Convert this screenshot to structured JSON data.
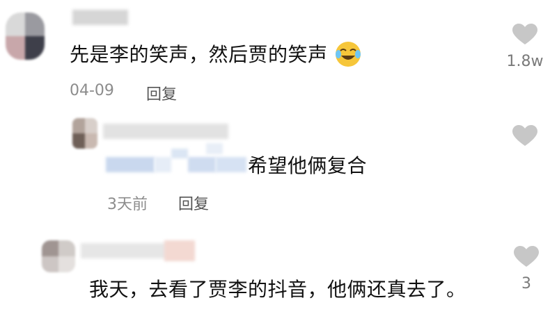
{
  "comments": [
    {
      "text": "先是李的笑声，然后贾的笑声",
      "date": "04-09",
      "reply_label": "回复",
      "like_count": "1.8w",
      "emoji": "laughing-crying-emoji"
    },
    {
      "text": "希望他俩复合",
      "date": "3天前",
      "reply_label": "回复",
      "like_count": ""
    },
    {
      "text": "我天，去看了贾李的抖音，他俩还真去了。",
      "like_count": "3"
    }
  ],
  "icons": {
    "like": "heart-icon",
    "avatar": "blurred-avatar"
  },
  "colors": {
    "heart": "#c7c7c7",
    "meta": "#8c8c8c",
    "emoji": "#f6c63a"
  }
}
